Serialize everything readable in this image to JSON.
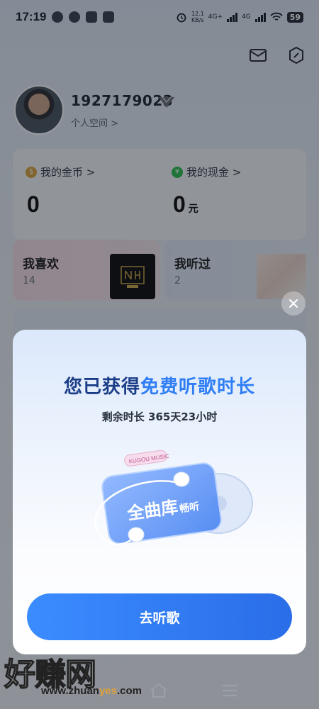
{
  "status_bar": {
    "time": "17:19",
    "net_speed_value": "12.1",
    "net_speed_unit": "KB/s",
    "signal1_label": "4G+",
    "signal2_label": "4G",
    "battery": "59"
  },
  "profile": {
    "user_id": "1927179023",
    "space_label": "个人空间 >"
  },
  "wallet": {
    "coins_label": "我的金币 >",
    "coins_icon_text": "$",
    "coins_value": "0",
    "cash_label": "我的现金 >",
    "cash_icon_text": "¥",
    "cash_value": "0",
    "cash_unit": "元"
  },
  "cards": {
    "like_title": "我喜欢",
    "like_count": "14",
    "heard_title": "我听过",
    "heard_count": "2"
  },
  "modal": {
    "title_prefix": "您已获得",
    "title_highlight": "免费听歌时长",
    "subtitle": "剩余时长 365天23小时",
    "card_brand": "KUGOU MUSIC",
    "card_main": "全曲库",
    "card_sub": "畅听",
    "cta_label": "去听歌"
  },
  "watermark": {
    "main": "好赚网",
    "url_prefix": "www.zhuan",
    "url_highlight": "yes",
    "url_suffix": ".com"
  },
  "colors": {
    "accent": "#2f7ef5",
    "title_dark": "#1b3e88",
    "cta_start": "#3b8cff",
    "cta_end": "#2a6de8"
  }
}
